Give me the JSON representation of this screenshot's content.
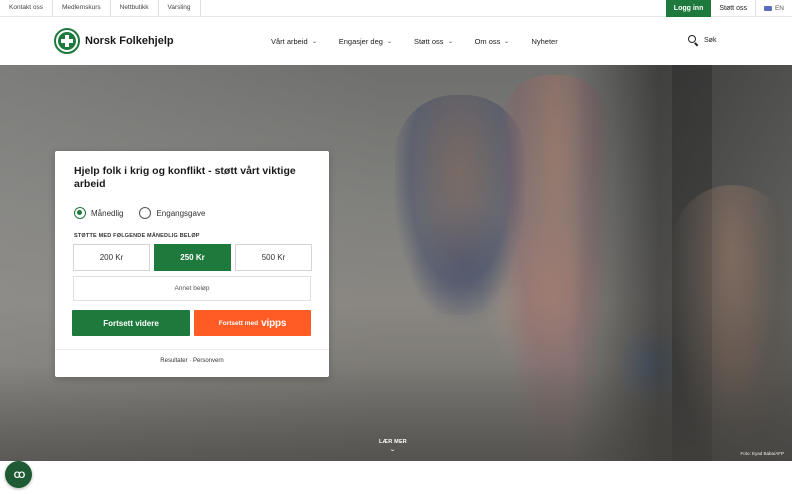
{
  "topbar": {
    "links": [
      "Kontakt oss",
      "Medlemskurs",
      "Nettbutikk",
      "Varsling"
    ],
    "login_label": "Logg inn",
    "support_label": "Støtt oss",
    "language_label": "EN"
  },
  "header": {
    "logo_text": "Norsk Folkehjelp",
    "menu": [
      "Vårt arbeid",
      "Engasjer deg",
      "Støtt oss",
      "Om oss",
      "Nyheter"
    ],
    "search_label": "Søk"
  },
  "hero": {
    "photo_credit": "Foto: Eyad Baba/AFP",
    "learn_more_label": "LÆR MER"
  },
  "donation": {
    "title": "Hjelp folk i krig og konflikt - støtt vårt viktige arbeid",
    "frequency_options": [
      "Månedlig",
      "Engangsgave"
    ],
    "selected_frequency": "Månedlig",
    "amount_heading": "STØTTE MED FØLGENDE MÅNEDLIG BELØP",
    "amounts": [
      "200 Kr",
      "250 Kr",
      "500 Kr"
    ],
    "selected_amount": "250 Kr",
    "other_amount_placeholder": "Annet beløp",
    "continue_label": "Fortsett videre",
    "vipps_prefix": "Fortsett med",
    "vipps_brand": "vipps",
    "footer_links": [
      "Resultater",
      "Personvern"
    ]
  },
  "cookie_badge": {
    "glyph": "CO"
  },
  "colors": {
    "brand_green": "#1e7a3c",
    "vipps_orange": "#ff5b24"
  }
}
